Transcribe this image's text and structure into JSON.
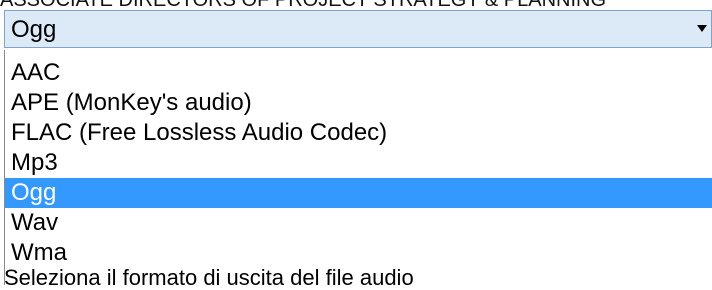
{
  "window": {
    "cut_header_text": "ASSOCIATE DIRECTORS OF PROJECT STRATEGY & PLANNING",
    "cut_footer_text": "Seleziona il formato di uscita del file audio"
  },
  "format_select": {
    "value": "Ogg",
    "options": [
      {
        "label": "AAC"
      },
      {
        "label": "APE (MonKey's audio)"
      },
      {
        "label": "FLAC (Free Lossless Audio Codec)"
      },
      {
        "label": "Mp3"
      },
      {
        "label": "Ogg",
        "selected": true
      },
      {
        "label": "Wav"
      },
      {
        "label": "Wma"
      }
    ]
  },
  "colors": {
    "selection": "#3399ff",
    "combo_background": "#dceaf7"
  }
}
